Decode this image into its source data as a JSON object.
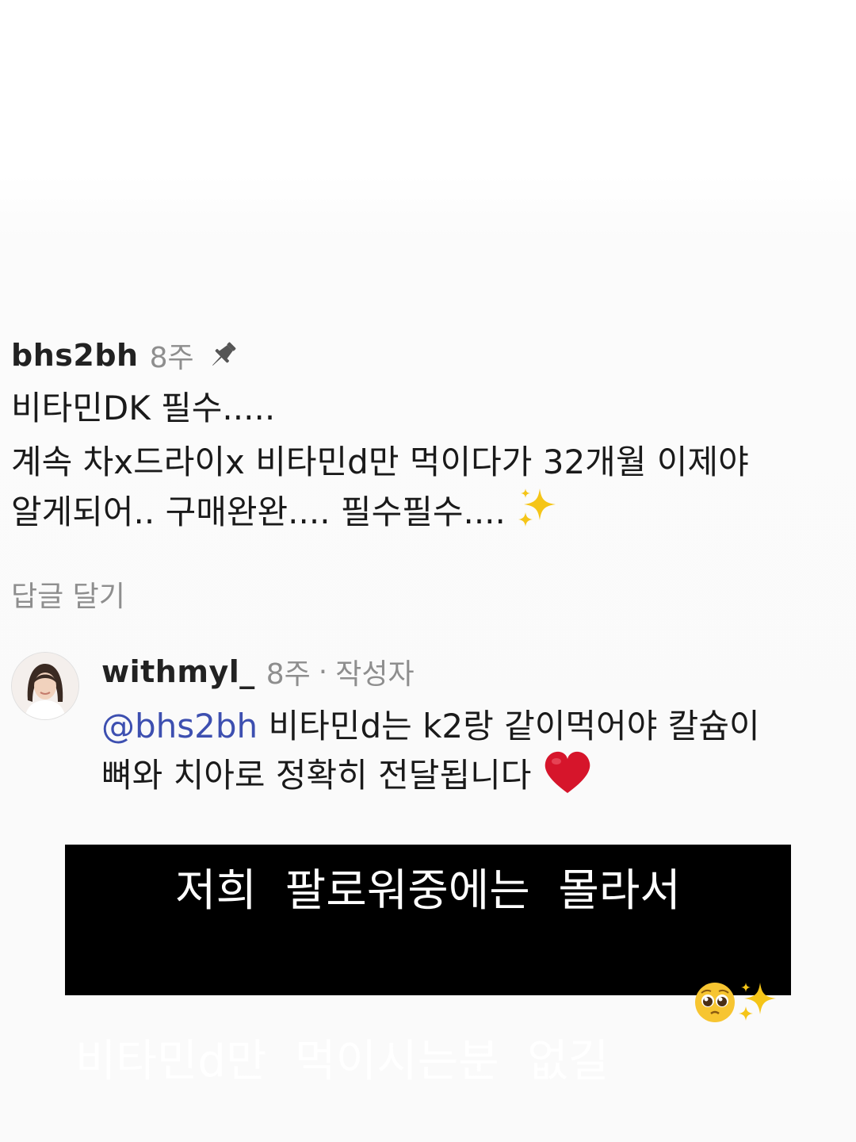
{
  "comment": {
    "username": "bhs2bh",
    "time": "8주",
    "pin_icon": "pin-icon",
    "line1": "비타민DK 필수.....",
    "line2": "계속 차x드라이x 비타민d만 먹이다가 32개월 이제야",
    "line3": "알게되어.. 구매완완.... 필수필수....",
    "reply_label": "답글 달기"
  },
  "reply": {
    "username": "withmyl_",
    "time": "8주",
    "separator": "·",
    "author_badge": "작성자",
    "mention": "@bhs2bh",
    "text1": " 비타민d는 k2랑 같이먹어야 칼슘이",
    "text2": "뼈와 치아로 정확히 전달됩니다",
    "avatar": "avatar"
  },
  "caption": {
    "line1": "저희  팔로워중에는  몰라서",
    "line2": "비타민d만  먹이시는분  없길"
  },
  "colors": {
    "mention": "#3d4fb0",
    "muted": "#8e8e8e",
    "caption_bg": "#000000",
    "heart": "#d6152b"
  }
}
